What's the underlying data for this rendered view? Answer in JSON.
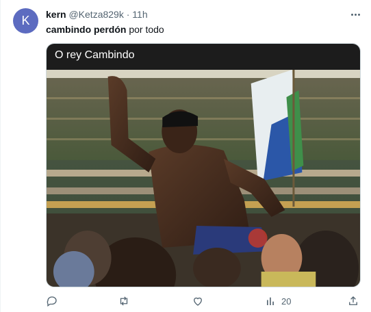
{
  "post": {
    "avatar_letter": "K",
    "author_name": "kern",
    "handle": "@Ketza829k",
    "separator": "·",
    "time": "11h",
    "text_bold": "cambindo perdón",
    "text_rest": " por todo",
    "media_caption": "O rey Cambindo"
  },
  "actions": {
    "views_count": "20"
  },
  "colors": {
    "accent": "#5c6bc0",
    "muted": "#536471",
    "caption_bar": "#1c1c1c"
  },
  "icons": [
    "more-icon",
    "reply-icon",
    "repost-icon",
    "like-icon",
    "views-icon",
    "share-icon"
  ]
}
